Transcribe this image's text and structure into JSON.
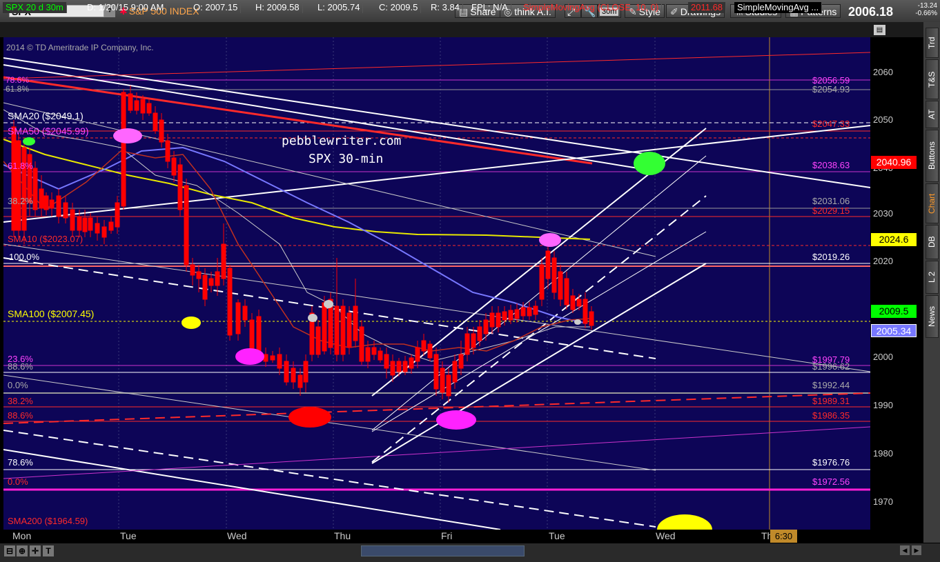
{
  "toolbar": {
    "symbol": "SPX",
    "symbol_desc": "S&P 500 INDEX",
    "share": "Share",
    "think_ai": "think A.I.",
    "timeframe": "30m",
    "style": "Style",
    "drawings": "Drawings",
    "studies": "Studies",
    "patterns": "Patterns",
    "last_price": "2006.18",
    "change": "-13.24",
    "change_pct": "-0.66%"
  },
  "infobar": {
    "chart_id": "SPX 20 d 30m",
    "date": "D: 1/20/15 9:00 AM",
    "open": "O: 2007.15",
    "high": "H: 2009.58",
    "low": "L: 2005.74",
    "close": "C: 2009.5",
    "range": "R: 3.84",
    "fpl": "FPL: N/A",
    "study1": "SimpleMovingAvg (CLOSE, 10, 0)",
    "study1_value": "2011.68",
    "study2": "SimpleMovingAvg ..."
  },
  "chart": {
    "copyright": "2014 © TD Ameritrade IP Company, Inc.",
    "note_line1": "pebblewriter.com",
    "note_line2": "SPX 30-min",
    "left_labels": {
      "sma20": "SMA20 ($2049.1)",
      "sma50": "SMA50 ($2045.99)",
      "sma10": "SMA10 ($2023.07)",
      "sma100": "SMA100 ($2007.45)",
      "sma200": "SMA200 ($1964.59)",
      "f786a": "78.6%",
      "f618a": "61.8%",
      "f618b": "61.8%",
      "f382a": "38.2%",
      "f100": "100.0%",
      "f236": "23.6%",
      "f886a": "88.6%",
      "f00": "0.0%",
      "f382b": "38.2%",
      "f886b": "88.6%",
      "f786b": "78.6%",
      "f00b": "0.0%"
    },
    "right_labels": {
      "r2056": "$2056.59",
      "r2054": "$2054.93",
      "r2047": "$2047.33",
      "r2038": "$2038.63",
      "r2031": "$2031.06",
      "r2029": "$2029.15",
      "r2019": "$2019.26",
      "r1997": "$1997.79",
      "r1996": "$1996.62",
      "r1992": "$1992.44",
      "r1989": "$1989.31",
      "r1986": "$1986.35",
      "r1976": "$1976.76",
      "r1972": "$1972.56"
    }
  },
  "yaxis": {
    "ticks": [
      "2060",
      "2050",
      "2040",
      "2030",
      "2020",
      "2010",
      "2000",
      "1990",
      "1980",
      "1970"
    ],
    "tag_2040": "2040.96",
    "tag_2024": "2024.6",
    "tag_2009": "2009.5",
    "tag_2005": "2005.34"
  },
  "xaxis": {
    "days": [
      "Mon",
      "Tue",
      "Wed",
      "Thu",
      "Fri",
      "Tue",
      "Wed",
      "Th"
    ],
    "time_badge": "6:30"
  },
  "sidebar": {
    "tabs": [
      "Trd",
      "T&S",
      "AT",
      "Buttons",
      "Chart",
      "DB",
      "L 2",
      "News"
    ]
  },
  "colors": {
    "chart_bg": "#0d0557",
    "up": "#00ff00",
    "down": "#ff0000",
    "accent": "#ff9a2a"
  }
}
